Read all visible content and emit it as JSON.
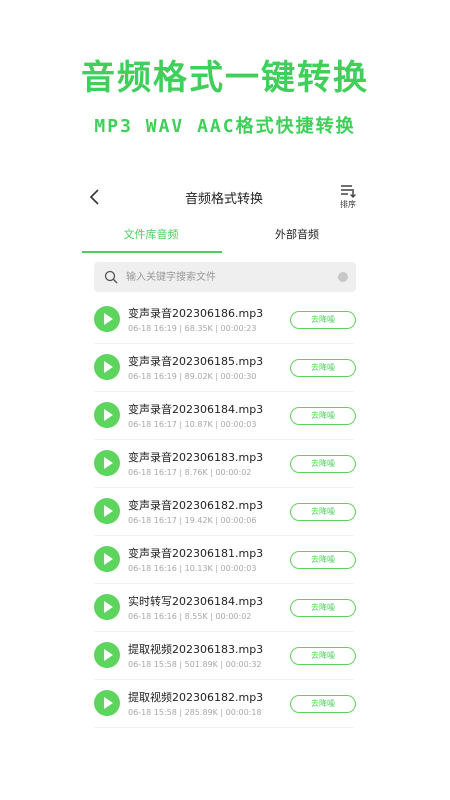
{
  "promo": {
    "title": "音频格式一键转换",
    "subtitle": "MP3  WAV AAC格式快捷转换"
  },
  "nav": {
    "title": "音频格式转换",
    "sort_label": "排序"
  },
  "tabs": [
    {
      "label": "文件库音频",
      "active": true
    },
    {
      "label": "外部音频",
      "active": false
    }
  ],
  "search": {
    "placeholder": "输入关键字搜索文件"
  },
  "files": [
    {
      "name": "变声录音202306186.mp3",
      "meta": "06-18 16:19 | 68.35K | 00:00:23",
      "action": "去降噪"
    },
    {
      "name": "变声录音202306185.mp3",
      "meta": "06-18 16:19 | 89.02K | 00:00:30",
      "action": "去降噪"
    },
    {
      "name": "变声录音202306184.mp3",
      "meta": "06-18 16:17 | 10.87K | 00:00:03",
      "action": "去降噪"
    },
    {
      "name": "变声录音202306183.mp3",
      "meta": "06-18 16:17 | 8.76K | 00:00:02",
      "action": "去降噪"
    },
    {
      "name": "变声录音202306182.mp3",
      "meta": "06-18 16:17 | 19.42K | 00:00:06",
      "action": "去降噪"
    },
    {
      "name": "变声录音202306181.mp3",
      "meta": "06-18 16:16 | 10.13K | 00:00:03",
      "action": "去降噪"
    },
    {
      "name": "实时转写202306184.mp3",
      "meta": "06-18 16:16 | 8.55K | 00:00:02",
      "action": "去降噪"
    },
    {
      "name": "提取视频202306183.mp3",
      "meta": "06-18 15:58 | 501.89K | 00:00:32",
      "action": "去降噪"
    },
    {
      "name": "提取视频202306182.mp3",
      "meta": "06-18 15:58 | 285.89K | 00:00:18",
      "action": "去降噪"
    }
  ],
  "colors": {
    "accent": "#4ccf5f",
    "play": "#5ed45f"
  }
}
